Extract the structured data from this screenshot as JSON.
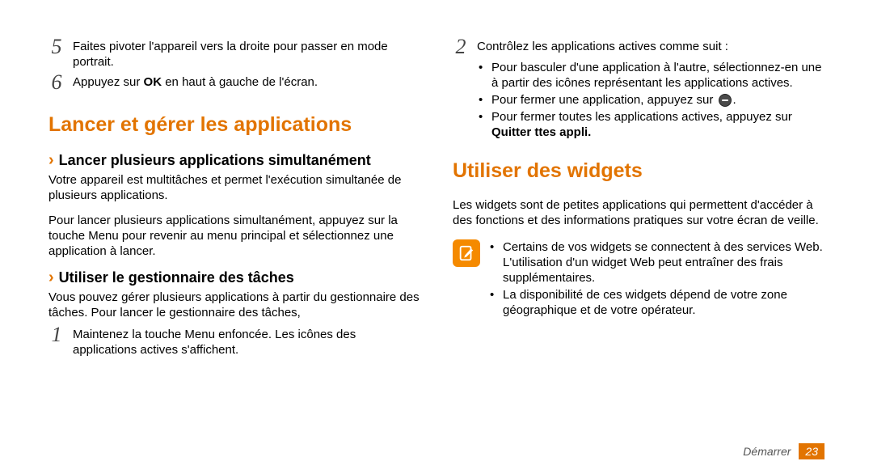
{
  "left": {
    "step5": {
      "num": "5",
      "text": "Faites pivoter l'appareil vers la droite pour passer en mode portrait."
    },
    "step6": {
      "num": "6",
      "prefix": "Appuyez sur ",
      "bold": "OK",
      "suffix": " en haut à gauche de l'écran."
    },
    "h1": "Lancer et gérer les applications",
    "h2a": "Lancer plusieurs applications simultanément",
    "para1": "Votre appareil est multitâches et permet l'exécution simultanée de plusieurs applications.",
    "para2": "Pour lancer plusieurs applications simultanément, appuyez sur la touche Menu pour revenir au menu principal et sélectionnez une application à lancer.",
    "h2b": "Utiliser le gestionnaire des tâches",
    "para3": "Vous pouvez gérer plusieurs applications à partir du gestionnaire des tâches. Pour lancer le gestionnaire des tâches,",
    "step1b": {
      "num": "1",
      "text": "Maintenez la touche Menu enfoncée. Les icônes des applications actives s'affichent."
    }
  },
  "right": {
    "step2": {
      "num": "2",
      "text": "Contrôlez les applications actives comme suit :"
    },
    "bullets1": {
      "a": "Pour basculer d'une application à l'autre, sélectionnez-en une à partir des icônes représentant les applications actives.",
      "b_prefix": "Pour fermer une application, appuyez sur ",
      "b_suffix": ".",
      "c_prefix": "Pour fermer toutes les applications actives, appuyez sur ",
      "c_bold": "Quitter ttes appli.",
      "c_suffix": ""
    },
    "h1": "Utiliser des widgets",
    "para1": "Les widgets sont de petites applications qui permettent d'accéder à des fonctions et des informations pratiques sur votre écran de veille.",
    "note": {
      "a": "Certains de vos widgets se connectent à des services Web. L'utilisation d'un widget Web peut entraîner des frais supplémentaires.",
      "b": "La disponibilité de ces widgets dépend de votre zone géographique et de votre opérateur."
    }
  },
  "footer": {
    "section": "Démarrer",
    "page": "23"
  }
}
